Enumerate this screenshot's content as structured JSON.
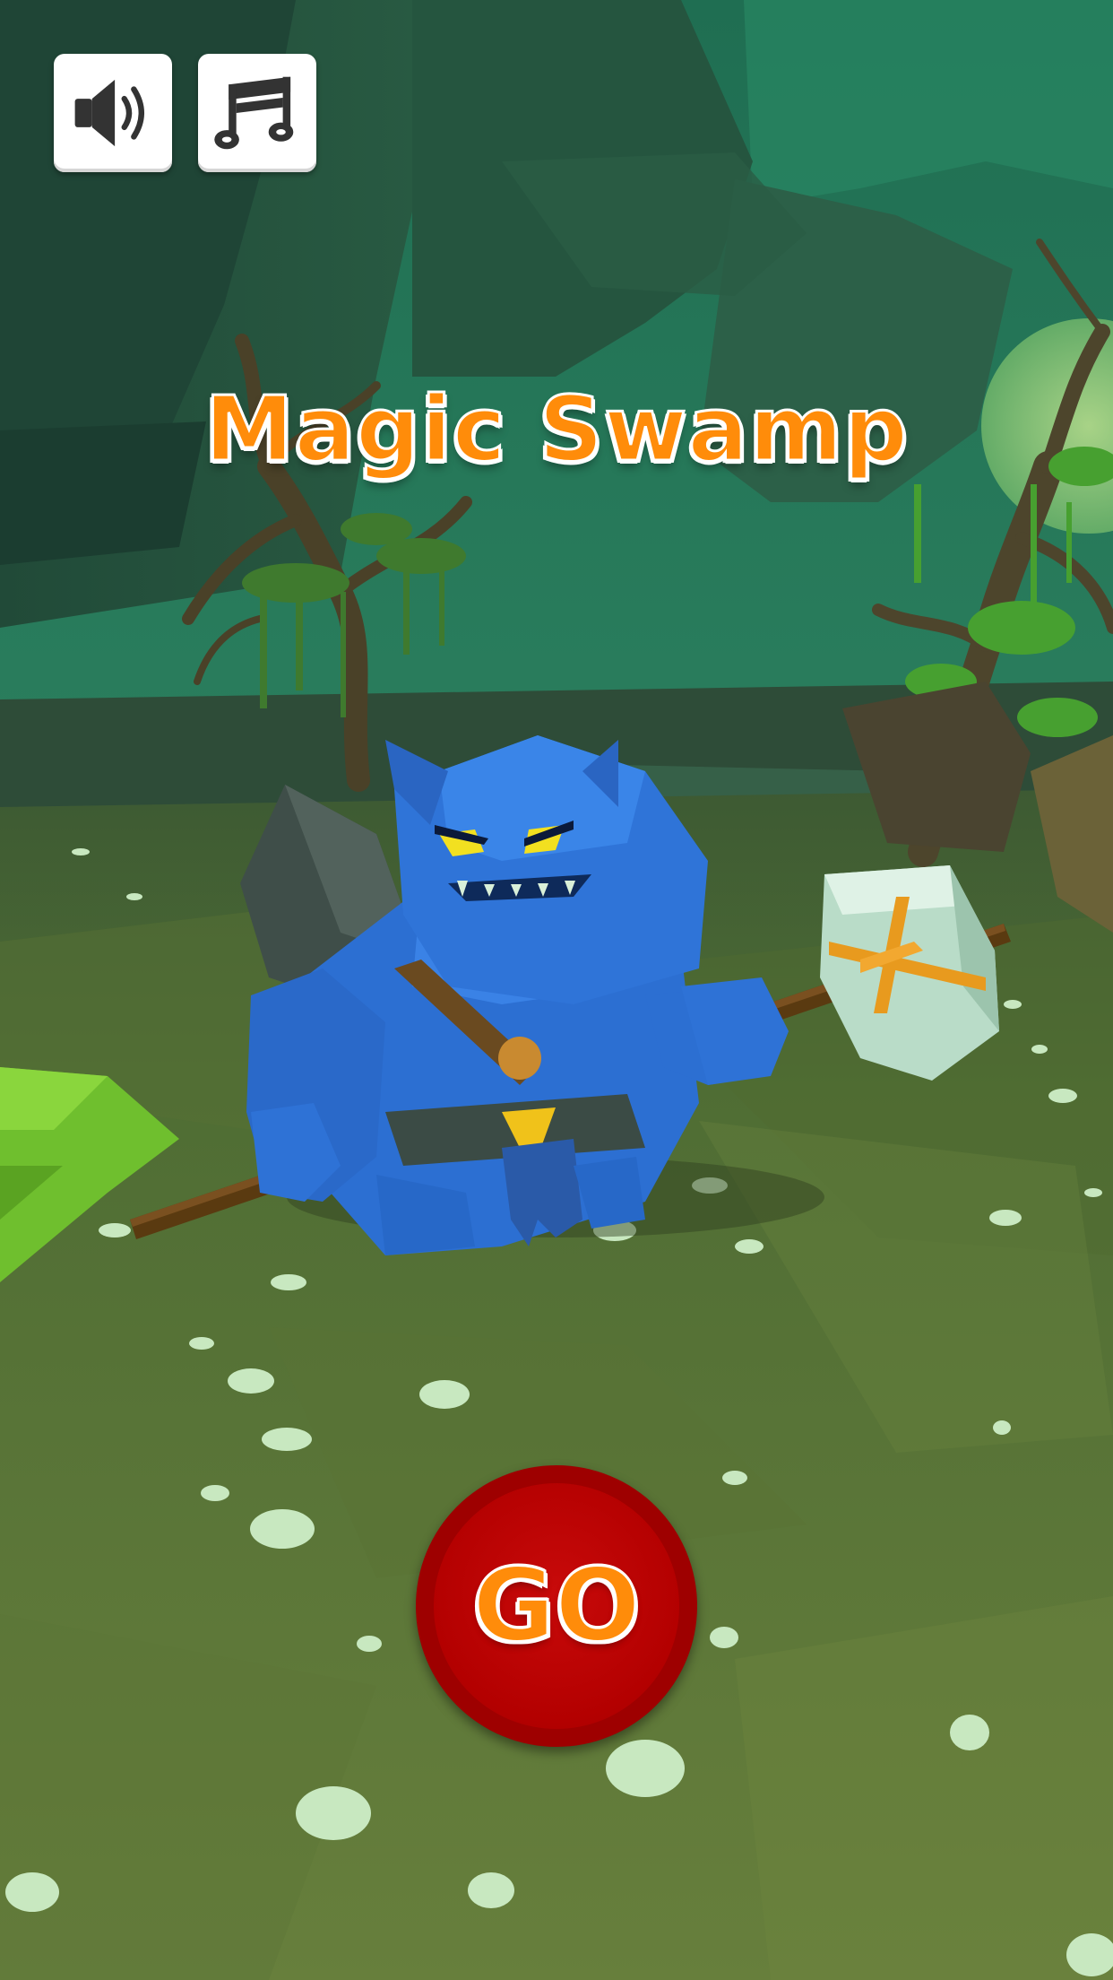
{
  "game": {
    "title": "Magic Swamp",
    "go_label": "GO"
  },
  "controls": {
    "sound_icon": "speaker-volume-icon",
    "music_icon": "music-notes-icon"
  },
  "colors": {
    "title_orange": "#ff8c0a",
    "go_button_red": "#b30000",
    "icon_button_bg": "#ffffff",
    "icon_color": "#333333",
    "ogre_blue": "#2f6fd6",
    "swamp_ground": "#5f7a38"
  }
}
